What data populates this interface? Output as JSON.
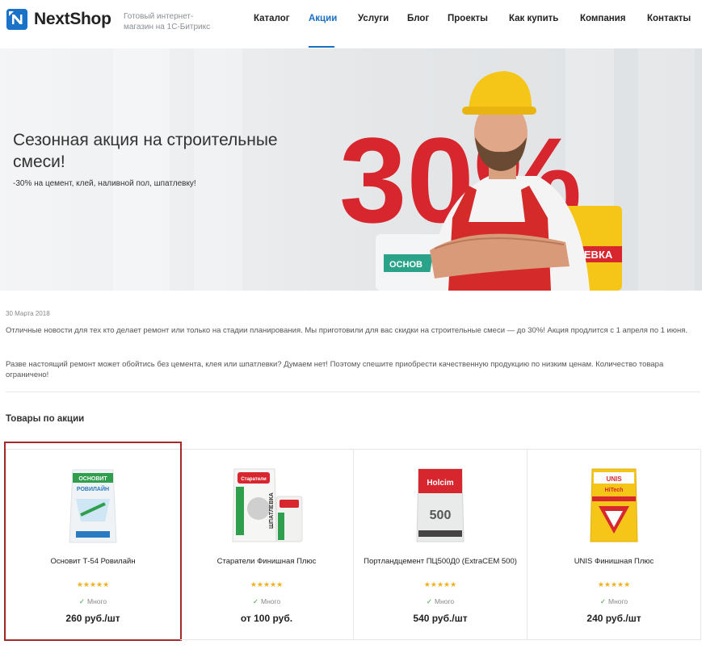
{
  "header": {
    "logo_text": "NextShop",
    "tagline": "Готовый интернет-магазин на 1С-Битрикс",
    "nav": [
      {
        "label": "Каталог",
        "active": false
      },
      {
        "label": "Акции",
        "active": true
      },
      {
        "label": "Услуги",
        "active": false
      },
      {
        "label": "Блог",
        "active": false
      },
      {
        "label": "Проекты",
        "active": false
      },
      {
        "label": "Как купить",
        "active": false
      },
      {
        "label": "Компания",
        "active": false
      },
      {
        "label": "Контакты",
        "active": false
      }
    ]
  },
  "banner": {
    "title": "Сезонная акция на строительные смеси!",
    "subtitle": "-30% на цемент, клей, наливной пол, шпатлевку!",
    "promo_text": "30%",
    "bag_label_left": "ОСНОВ",
    "bag_label_right": "ШПАТЛЕВКА"
  },
  "article": {
    "date": "30 Марта 2018",
    "paragraph1": "Отличные новости для тех кто делает ремонт или только на стадии планирования. Мы приготовили для вас скидки на строительные смеси — до 30%! Акция продлится с 1 апреля по 1 июня.",
    "paragraph2": "Разве настоящий ремонт может обойтись без цемента, клея или шпатлевки? Думаем нет! Поэтому спешите приобрести качественную продукцию по низким ценам. Количество товара ограничено!"
  },
  "products_section": {
    "title": "Товары по акции",
    "items": [
      {
        "name": "Основит Т-54 Ровилайн",
        "stars": "★★★★★",
        "stock": "Много",
        "price": "260 руб./шт",
        "bag_text": "РОВИЛАЙН",
        "brand": "ОСНОВИТ"
      },
      {
        "name": "Старатели Финишная Плюс",
        "stars": "★★★★★",
        "stock": "Много",
        "price": "от 100 руб.",
        "bag_text": "ШПАТЛЕВКА",
        "brand": "Старатели"
      },
      {
        "name": "Портландцемент ПЦ500Д0 (ExtraCEM 500)",
        "stars": "★★★★★",
        "stock": "Много",
        "price": "540 руб./шт",
        "bag_text": "500",
        "brand": "Holcim"
      },
      {
        "name": "UNIS Финишная Плюс",
        "stars": "★★★★★",
        "stock": "Много",
        "price": "240 руб./шт",
        "bag_text": "HiTech",
        "brand": "UNIS"
      }
    ]
  },
  "colors": {
    "accent": "#1a6fc4",
    "selected_outline": "#a52a2a",
    "star": "#f2b01e",
    "stock_check": "#3ba13b",
    "promo_red": "#d7262e"
  }
}
